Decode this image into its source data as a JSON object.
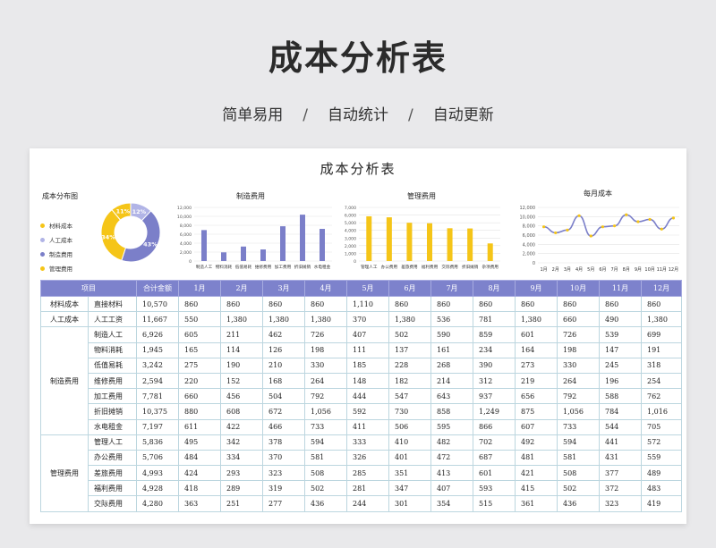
{
  "hero": {
    "title": "成本分析表",
    "tagline": [
      "简单易用",
      "自动统计",
      "自动更新"
    ],
    "separator": "/"
  },
  "sheet": {
    "title": "成本分析表"
  },
  "donut": {
    "title": "成本分布图",
    "legend": [
      {
        "label": "材料成本",
        "color": "#f5c518"
      },
      {
        "label": "人工成本",
        "color": "#b1b4e6"
      },
      {
        "label": "制造费用",
        "color": "#7b7fc9"
      },
      {
        "label": "管理费用",
        "color": "#f5c518"
      }
    ],
    "slices": [
      {
        "name": "人工成本",
        "percent": 12,
        "label": "12%",
        "color": "#b1b4e6"
      },
      {
        "name": "制造费用",
        "percent": 43,
        "label": "43%",
        "color": "#7b7fc9"
      },
      {
        "name": "管理费用",
        "percent": 34,
        "label": "34%",
        "color": "#f5c518"
      },
      {
        "name": "材料成本",
        "percent": 11,
        "label": "11%",
        "color": "#f5c518"
      }
    ]
  },
  "chart_data": [
    {
      "type": "bar",
      "title": "制造费用",
      "categories": [
        "制造人工",
        "物料消耗",
        "低值易耗",
        "维修费用",
        "加工费用",
        "折旧摊销",
        "水电租金"
      ],
      "values": [
        6926,
        1945,
        3242,
        2594,
        7781,
        10375,
        7197
      ],
      "ylim": [
        0,
        12000
      ],
      "yticks": [
        "0",
        "2,000",
        "4,000",
        "6,000",
        "8,000",
        "10,000",
        "12,000"
      ],
      "color": "#7b7fc9"
    },
    {
      "type": "bar",
      "title": "管理费用",
      "categories": [
        "管理人工",
        "办公费用",
        "差旅费用",
        "福利费用",
        "交际费用",
        "折旧摊销",
        "杂项费用"
      ],
      "values": [
        5836,
        5706,
        4993,
        4928,
        4280,
        4250,
        2300
      ],
      "ylim": [
        0,
        7000
      ],
      "yticks": [
        "0",
        "1,000",
        "2,000",
        "3,000",
        "4,000",
        "5,000",
        "6,000",
        "7,000"
      ],
      "color": "#f5c518"
    },
    {
      "type": "line",
      "title": "每月成本",
      "categories": [
        "1月",
        "2月",
        "3月",
        "4月",
        "5月",
        "6月",
        "7月",
        "8月",
        "9月",
        "10月",
        "11月",
        "12月"
      ],
      "values": [
        7800,
        6500,
        7100,
        10200,
        5800,
        7800,
        8000,
        10400,
        8900,
        9400,
        7300,
        9700
      ],
      "ylim": [
        0,
        12000
      ],
      "yticks": [
        "0",
        "2,000",
        "4,000",
        "6,000",
        "8,000",
        "10,000",
        "12,000"
      ],
      "line_color": "#7b7fc9",
      "point_color": "#f5c518"
    }
  ],
  "table": {
    "headers": [
      "项目",
      "",
      "合计金额",
      "1月",
      "2月",
      "3月",
      "4月",
      "5月",
      "6月",
      "7月",
      "8月",
      "9月",
      "10月",
      "11月",
      "12月"
    ],
    "groups": [
      {
        "category": "材料成本",
        "rows": [
          [
            "直接材料",
            "10,570",
            "860",
            "860",
            "860",
            "860",
            "1,110",
            "860",
            "860",
            "860",
            "860",
            "860",
            "860",
            "860"
          ]
        ]
      },
      {
        "category": "人工成本",
        "rows": [
          [
            "人工工资",
            "11,667",
            "550",
            "1,380",
            "1,380",
            "1,380",
            "370",
            "1,380",
            "536",
            "781",
            "1,380",
            "660",
            "490",
            "1,380"
          ]
        ]
      },
      {
        "category": "制造费用",
        "rows": [
          [
            "制造人工",
            "6,926",
            "605",
            "211",
            "462",
            "726",
            "407",
            "502",
            "590",
            "859",
            "601",
            "726",
            "539",
            "699"
          ],
          [
            "物料消耗",
            "1,945",
            "165",
            "114",
            "126",
            "198",
            "111",
            "137",
            "161",
            "234",
            "164",
            "198",
            "147",
            "191"
          ],
          [
            "低值易耗",
            "3,242",
            "275",
            "190",
            "210",
            "330",
            "185",
            "228",
            "268",
            "390",
            "273",
            "330",
            "245",
            "318"
          ],
          [
            "维修费用",
            "2,594",
            "220",
            "152",
            "168",
            "264",
            "148",
            "182",
            "214",
            "312",
            "219",
            "264",
            "196",
            "254"
          ],
          [
            "加工费用",
            "7,781",
            "660",
            "456",
            "504",
            "792",
            "444",
            "547",
            "643",
            "937",
            "656",
            "792",
            "588",
            "762"
          ],
          [
            "折旧摊销",
            "10,375",
            "880",
            "608",
            "672",
            "1,056",
            "592",
            "730",
            "858",
            "1,249",
            "875",
            "1,056",
            "784",
            "1,016"
          ],
          [
            "水电租金",
            "7,197",
            "611",
            "422",
            "466",
            "733",
            "411",
            "506",
            "595",
            "866",
            "607",
            "733",
            "544",
            "705"
          ]
        ]
      },
      {
        "category": "管理费用",
        "rows": [
          [
            "管理人工",
            "5,836",
            "495",
            "342",
            "378",
            "594",
            "333",
            "410",
            "482",
            "702",
            "492",
            "594",
            "441",
            "572"
          ],
          [
            "办公费用",
            "5,706",
            "484",
            "334",
            "370",
            "581",
            "326",
            "401",
            "472",
            "687",
            "481",
            "581",
            "431",
            "559"
          ],
          [
            "差旅费用",
            "4,993",
            "424",
            "293",
            "323",
            "508",
            "285",
            "351",
            "413",
            "601",
            "421",
            "508",
            "377",
            "489"
          ],
          [
            "福利费用",
            "4,928",
            "418",
            "289",
            "319",
            "502",
            "281",
            "347",
            "407",
            "593",
            "415",
            "502",
            "372",
            "483"
          ],
          [
            "交际费用",
            "4,280",
            "363",
            "251",
            "277",
            "436",
            "244",
            "301",
            "354",
            "515",
            "361",
            "436",
            "323",
            "419"
          ]
        ]
      }
    ]
  }
}
